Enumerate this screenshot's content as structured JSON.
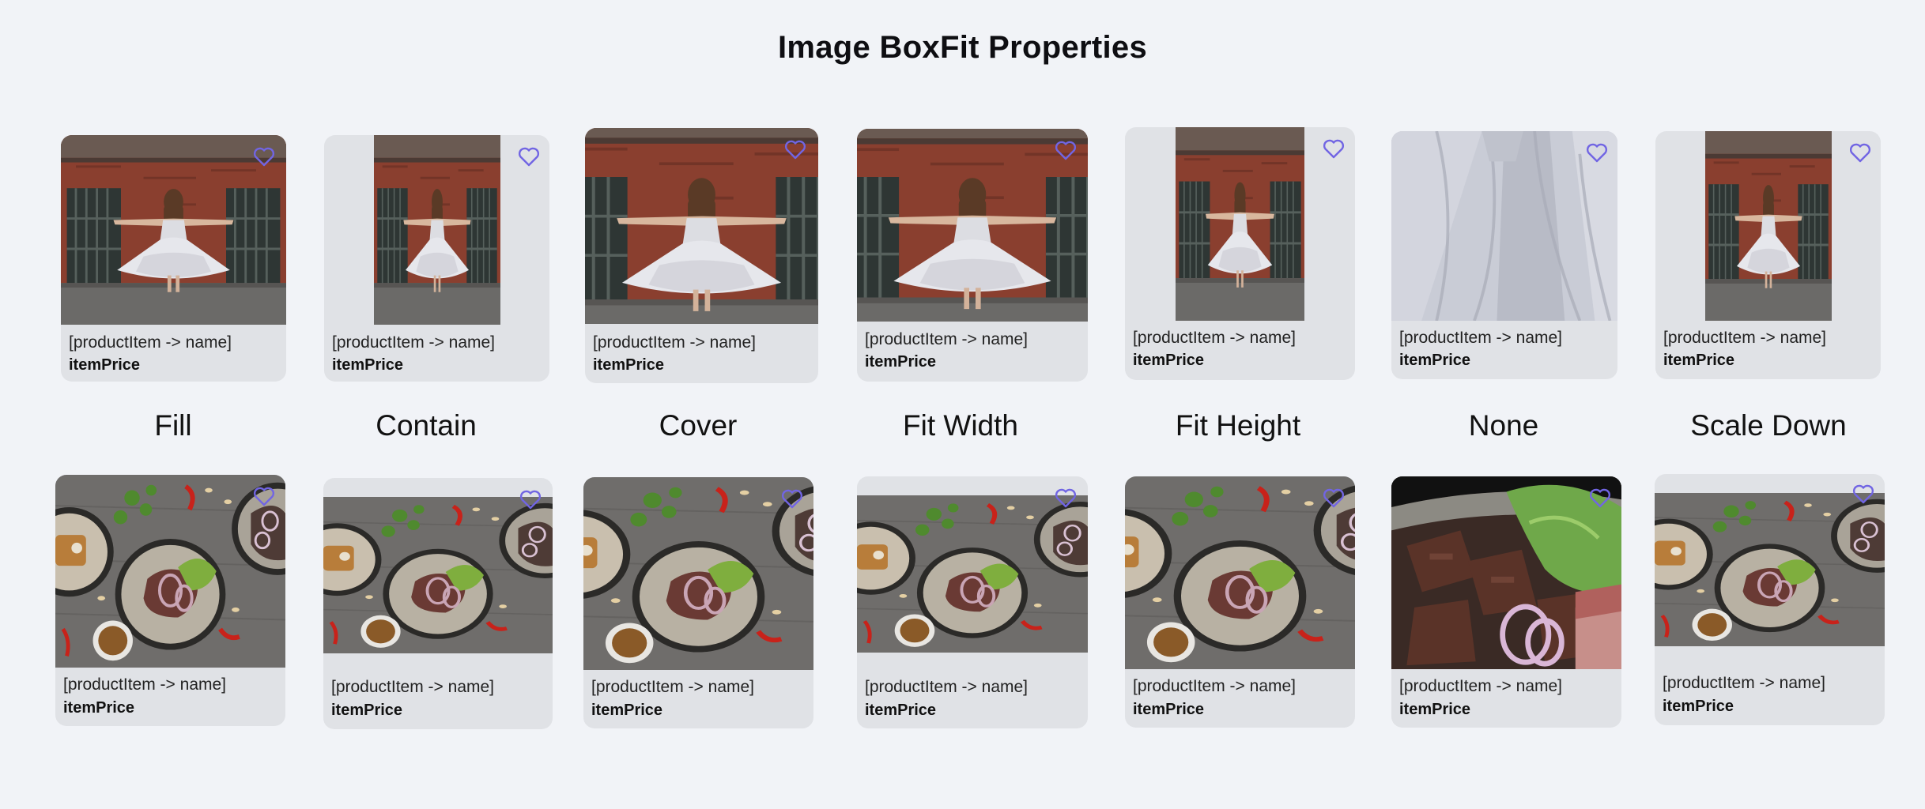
{
  "page": {
    "title": "Image BoxFit Properties"
  },
  "colors": {
    "background": "#f1f3f7",
    "card": "#e0e2e6",
    "heart": "#7165e3"
  },
  "fit_labels": [
    "Fill",
    "Contain",
    "Cover",
    "Fit Width",
    "Fit Height",
    "None",
    "Scale Down"
  ],
  "cards": {
    "name_text": "[productItem -> name]",
    "price_text": "itemPrice",
    "favorite_icon": "heart-outline-icon"
  },
  "rows": [
    {
      "subject": "dress-photo"
    },
    {
      "subject": "food-photo"
    }
  ]
}
